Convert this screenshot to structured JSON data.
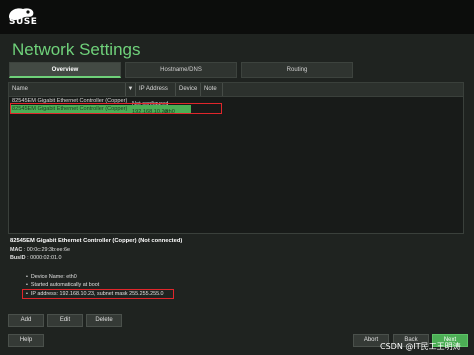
{
  "brand": {
    "logo_text": "SUSE"
  },
  "page": {
    "title": "Network Settings"
  },
  "tabs": [
    {
      "label": "Overview",
      "active": true
    },
    {
      "label": "Hostname/DNS",
      "active": false
    },
    {
      "label": "Routing",
      "active": false
    }
  ],
  "table": {
    "columns": [
      "Name",
      "IP Address",
      "Device",
      "Note"
    ],
    "sort_indicator": "▼",
    "rows": [
      {
        "name": "82545EM Gigabit Ethernet Controller (Copper)",
        "ip": "Not configured",
        "device": "",
        "note": ""
      },
      {
        "name": "82545EM Gigabit Ethernet Controller (Copper)",
        "ip": "192.168.10.23",
        "device": "eth0",
        "note": "",
        "selected": true
      }
    ]
  },
  "details": {
    "title": "82545EM Gigabit Ethernet Controller (Copper) (Not connected)",
    "mac_label": "MAC",
    "mac_value": " : 00:0c:29:3b:ee:6e",
    "busid_label": "BusID",
    "busid_value": " : 0000:02:01.0",
    "bullets": [
      "Device Name: eth0",
      "Started automatically at boot",
      "IP address: 192.168.10.23, subnet mask 255.255.255.0"
    ]
  },
  "buttons": {
    "add": "Add",
    "edit": "Edit",
    "delete": "Delete",
    "help": "Help",
    "abort": "Abort",
    "back": "Back",
    "next": "Next"
  },
  "watermark": "CSDN @IT民工王明涛",
  "colors": {
    "accent": "#6fd17a",
    "selection": "#4cae55",
    "highlight": "#e0262b",
    "background": "#1f2320"
  }
}
